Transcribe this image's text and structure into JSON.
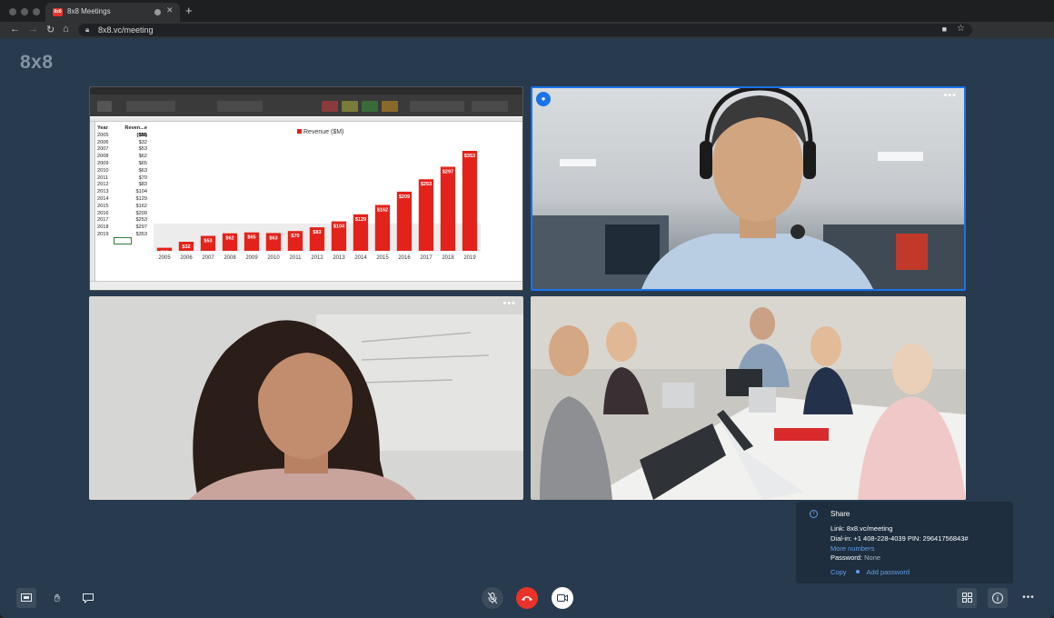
{
  "browser": {
    "tab_title": "8x8 Meetings",
    "tab_favicon_text": "8x8",
    "new_tab": "+",
    "url": "8x8.vc/meeting"
  },
  "app": {
    "logo": "8x8"
  },
  "spreadsheet": {
    "table_headers": [
      "Year",
      "Reven...e ($M)"
    ],
    "rows": [
      [
        "2005",
        "$11"
      ],
      [
        "2006",
        "$32"
      ],
      [
        "2007",
        "$53"
      ],
      [
        "2008",
        "$62"
      ],
      [
        "2009",
        "$65"
      ],
      [
        "2010",
        "$63"
      ],
      [
        "2011",
        "$70"
      ],
      [
        "2012",
        "$83"
      ],
      [
        "2013",
        "$104"
      ],
      [
        "2014",
        "$129"
      ],
      [
        "2015",
        "$162"
      ],
      [
        "2016",
        "$209"
      ],
      [
        "2017",
        "$253"
      ],
      [
        "2018",
        "$297"
      ],
      [
        "2019",
        "$353"
      ]
    ]
  },
  "chart_data": {
    "type": "bar",
    "title": "",
    "legend": [
      "Revenue ($M)"
    ],
    "legend_placement": "top-center",
    "categories": [
      "2005",
      "2006",
      "2007",
      "2008",
      "2009",
      "2010",
      "2011",
      "2012",
      "2013",
      "2014",
      "2015",
      "2016",
      "2017",
      "2018",
      "2019"
    ],
    "series": [
      {
        "name": "Revenue ($M)",
        "values": [
          11,
          32,
          53,
          62,
          65,
          63,
          70,
          83,
          104,
          129,
          162,
          209,
          253,
          297,
          353
        ]
      }
    ],
    "data_labels": [
      "$11",
      "$32",
      "$53",
      "$62",
      "$65",
      "$63",
      "$70",
      "$83",
      "$104",
      "$129",
      "$162",
      "$209",
      "$253",
      "$297",
      "$353"
    ],
    "ylim": [
      0,
      353
    ],
    "color": "#e3231b",
    "grid": false
  },
  "tiles": {
    "more_label": "•••",
    "speaker_icon": "speaking-indicator-icon"
  },
  "share": {
    "heading": "Share",
    "link_line": "Link: 8x8.vc/meeting",
    "dialin_line": "Dial-in: +1 408-228-4039 PIN: 29641756843#",
    "more_numbers": "More numbers",
    "password_label": "Password:",
    "password_value": "None",
    "copy": "Copy",
    "add_password": "Add password"
  },
  "toolbar": {
    "icons": [
      "screen-share-icon",
      "raise-hand-icon",
      "chat-icon",
      "mute-mic-icon",
      "hangup-icon",
      "camera-icon",
      "tile-view-icon",
      "info-icon",
      "more-icon"
    ],
    "more_label": "•••"
  },
  "colors": {
    "background": "#273a4e",
    "accent": "#1a73e8",
    "hangup": "#e8332b",
    "bar": "#e3231b"
  }
}
